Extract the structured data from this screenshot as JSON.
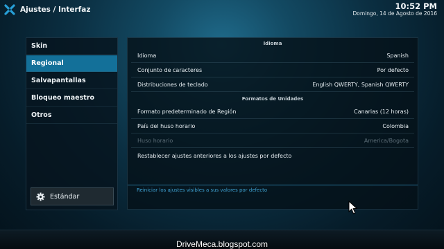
{
  "header": {
    "logo_icon": "kodi-logo-icon",
    "title": "Ajustes / Interfaz",
    "time": "10:52 PM",
    "date": "Domingo, 14 de Agosto de 2016"
  },
  "sidebar": {
    "items": [
      {
        "label": "Skin",
        "active": false
      },
      {
        "label": "Regional",
        "active": true
      },
      {
        "label": "Salvapantallas",
        "active": false
      },
      {
        "label": "Bloqueo maestro",
        "active": false
      },
      {
        "label": "Otros",
        "active": false
      }
    ],
    "level_button": {
      "icon": "gear-icon",
      "label": "Estándar"
    }
  },
  "panel": {
    "sections": [
      {
        "header": "Idioma",
        "rows": [
          {
            "label": "Idioma",
            "value": "Spanish",
            "enabled": true
          },
          {
            "label": "Conjunto de caracteres",
            "value": "Por defecto",
            "enabled": true
          },
          {
            "label": "Distribuciones de teclado",
            "value": "English QWERTY, Spanish QWERTY",
            "enabled": true
          }
        ]
      },
      {
        "header": "Formatos de Unidades",
        "rows": [
          {
            "label": "Formato predeterminado de Región",
            "value": "Canarias (12 horas)",
            "enabled": true
          },
          {
            "label": "País del huso horario",
            "value": "Colombia",
            "enabled": true
          },
          {
            "label": "Huso horario",
            "value": "America/Bogota",
            "enabled": false
          }
        ]
      }
    ],
    "reset_action": "Restablecer ajustes anteriores a los ajustes por defecto",
    "help_text": "Reiniciar los ajustes visibles a sus valores por defecto"
  },
  "watermark": "DriveMeca.blogspot.com",
  "colors": {
    "accent": "#137099",
    "help_text": "#3fa3d4",
    "disabled_text": "#5c6d77"
  }
}
